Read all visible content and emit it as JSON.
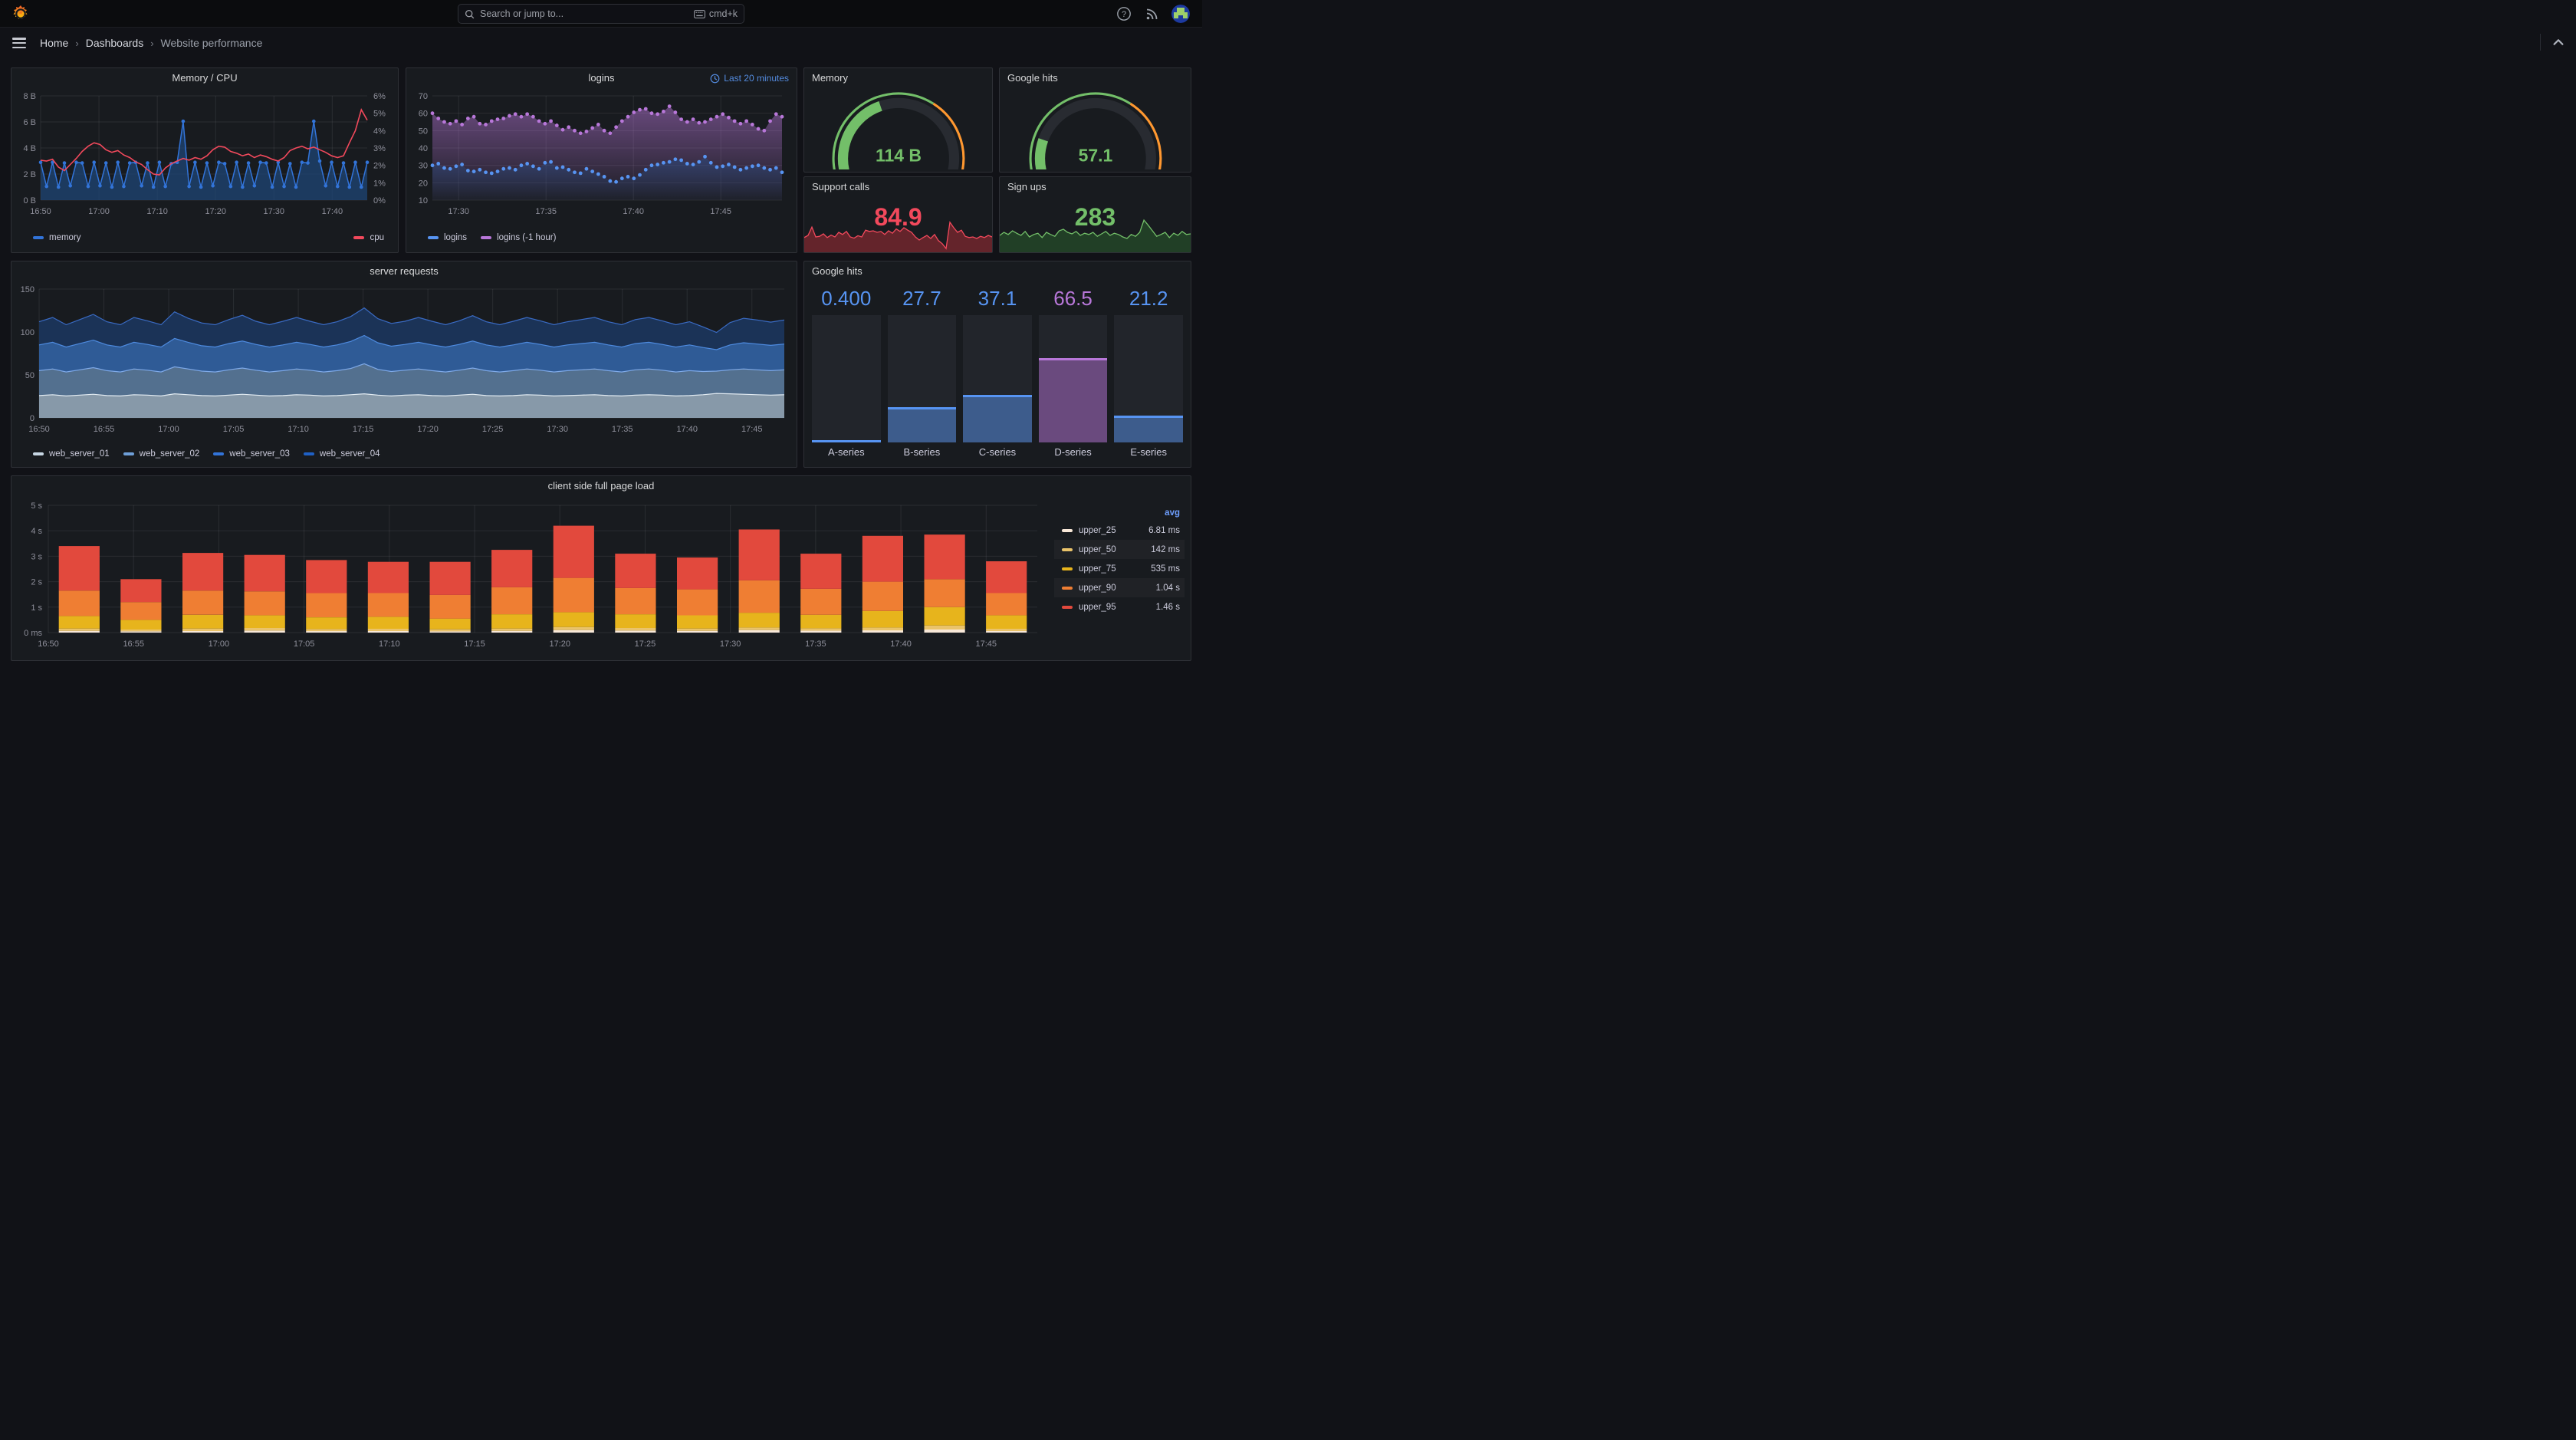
{
  "nav": {
    "search_placeholder": "Search or jump to...",
    "shortcut_label": "cmd+k"
  },
  "breadcrumb": {
    "home": "Home",
    "dashboards": "Dashboards",
    "current": "Website performance"
  },
  "panels": {
    "memory_cpu": {
      "title": "Memory / CPU",
      "legend": [
        {
          "label": "memory",
          "color": "#3274D9"
        },
        {
          "label": "cpu",
          "color": "#F2495C"
        }
      ]
    },
    "logins": {
      "title": "logins",
      "time_range": "Last 20 minutes",
      "legend": [
        {
          "label": "logins",
          "color": "#5794F2"
        },
        {
          "label": "logins (-1 hour)",
          "color": "#B877D9"
        }
      ]
    },
    "memory_gauge": {
      "title": "Memory",
      "value": "114 B"
    },
    "google_gauge": {
      "title": "Google hits",
      "value": "57.1"
    },
    "support_calls": {
      "title": "Support calls",
      "value": "84.9",
      "color": "#F2495C"
    },
    "sign_ups": {
      "title": "Sign ups",
      "value": "283",
      "color": "#73BF69"
    },
    "server_requests": {
      "title": "server requests",
      "legend": [
        {
          "label": "web_server_01",
          "color": "#C7D6E3"
        },
        {
          "label": "web_server_02",
          "color": "#6E9FD8"
        },
        {
          "label": "web_server_03",
          "color": "#3274D9"
        },
        {
          "label": "web_server_04",
          "color": "#1F60C4"
        }
      ]
    },
    "google_hits_bars": {
      "title": "Google hits"
    },
    "client_load": {
      "title": "client side full page load",
      "legend_header": "avg",
      "legend": [
        {
          "label": "upper_25",
          "avg": "6.81 ms",
          "color": "#F8E8D8"
        },
        {
          "label": "upper_50",
          "avg": "142 ms",
          "color": "#EAC36A"
        },
        {
          "label": "upper_75",
          "avg": "535 ms",
          "color": "#E7B41C"
        },
        {
          "label": "upper_90",
          "avg": "1.04 s",
          "color": "#EF7E33"
        },
        {
          "label": "upper_95",
          "avg": "1.46 s",
          "color": "#E2493D"
        }
      ]
    }
  },
  "chart_data": {
    "memcpu": {
      "type": "line",
      "title": "Memory / CPU",
      "x_ticks": [
        "16:50",
        "17:00",
        "17:10",
        "17:20",
        "17:30",
        "17:40"
      ],
      "y_left_ticks": [
        "0 B",
        "2 B",
        "4 B",
        "6 B",
        "8 B"
      ],
      "y_left_range": [
        0,
        8
      ],
      "y_right_ticks": [
        "0%",
        "1%",
        "2%",
        "3%",
        "4%",
        "5%",
        "6%"
      ],
      "y_right_range": [
        0,
        6
      ],
      "series": [
        {
          "name": "memory",
          "axis": "left",
          "color": "#3274D9",
          "fill": "rgba(31,70,120,0.72)",
          "points": true,
          "values": [
            2.9,
            1.05,
            2.9,
            1,
            2.85,
            1.1,
            2.9,
            2.85,
            1.05,
            2.9,
            1.1,
            2.85,
            1,
            2.9,
            1.05,
            2.85,
            2.9,
            1.1,
            2.85,
            1,
            2.9,
            1.05,
            2.8,
            2.9,
            6.05,
            1.05,
            2.9,
            1,
            2.85,
            1.1,
            2.9,
            2.8,
            1.05,
            2.9,
            1,
            2.85,
            1.1,
            2.9,
            2.85,
            1,
            2.9,
            1.05,
            2.8,
            1,
            2.9,
            2.85,
            6.05,
            3,
            1.1,
            2.9,
            1.05,
            2.85,
            1,
            2.9,
            1,
            2.9
          ]
        },
        {
          "name": "cpu",
          "axis": "right",
          "color": "#F2495C",
          "points": false,
          "values": [
            2.3,
            2.25,
            2.35,
            1.9,
            1.7,
            2.05,
            2.4,
            2.8,
            3.1,
            3.3,
            3.2,
            2.9,
            2.75,
            2.85,
            2.6,
            2.45,
            2.2,
            2.05,
            1.75,
            1.5,
            1.45,
            1.85,
            2.1,
            2.25,
            2.4,
            2.3,
            2.45,
            2.35,
            2.55,
            2.9,
            3.1,
            3.05,
            2.8,
            2.7,
            2.55,
            2.65,
            2.45,
            2.6,
            2.5,
            2.35,
            2.25,
            2.45,
            2.85,
            3,
            3.1,
            2.95,
            3.05,
            2.9,
            2.75,
            2.55,
            2.45,
            2.55,
            3.3,
            4,
            5.2,
            4.6
          ]
        }
      ]
    },
    "logins": {
      "type": "points",
      "title": "logins",
      "time_range": "Last 20 minutes",
      "x_ticks": [
        "17:30",
        "17:35",
        "17:40",
        "17:45"
      ],
      "x_tick_fracs": [
        0.075,
        0.325,
        0.575,
        0.825
      ],
      "y_ticks": [
        "10",
        "20",
        "30",
        "40",
        "50",
        "60",
        "70"
      ],
      "y_range": [
        10,
        70
      ],
      "series": [
        {
          "name": "logins (-1 hour)",
          "color": "#B877D9",
          "fill_top": "rgba(184,119,217,0.50)",
          "fill_bot": "rgba(184,119,217,0.03)",
          "values": [
            60,
            57,
            55,
            54,
            55.5,
            53.5,
            57,
            58,
            54,
            53.5,
            55.5,
            56.5,
            57,
            58.5,
            59.5,
            58,
            59.5,
            58,
            55.5,
            54,
            55.5,
            53,
            50.5,
            52,
            50,
            48.5,
            49.5,
            51.5,
            53.5,
            50,
            48.5,
            52,
            55.5,
            58,
            60.5,
            62,
            62.5,
            60,
            59.5,
            61,
            64,
            60.5,
            56.5,
            55,
            56.5,
            54.5,
            55,
            56.5,
            58,
            59.5,
            57.5,
            55.5,
            54,
            55.5,
            53.5,
            51,
            50,
            55.5,
            59.5,
            58
          ]
        },
        {
          "name": "logins",
          "color": "#5794F2",
          "fill_top": "rgba(40,75,130,0.55)",
          "fill_bot": "rgba(40,75,130,0.05)",
          "values": [
            30,
            31,
            28.5,
            28,
            29.5,
            30.5,
            27,
            26.5,
            27.5,
            26,
            25.5,
            26.5,
            28,
            28.5,
            27.5,
            30,
            31,
            29.5,
            28,
            31.5,
            32,
            28.5,
            29,
            27.5,
            26,
            25.5,
            28,
            26.5,
            25,
            23.5,
            21,
            20.5,
            22.5,
            23.5,
            22.5,
            24.5,
            27.5,
            30,
            30.5,
            31.5,
            32,
            33.5,
            33,
            31,
            30.5,
            32,
            35,
            31.5,
            29,
            29.5,
            30.5,
            29,
            27.5,
            28.5,
            29.5,
            30,
            28.5,
            27.5,
            28.5,
            26
          ]
        }
      ]
    },
    "server": {
      "type": "stacked_area",
      "title": "server requests",
      "x_ticks": [
        "16:50",
        "16:55",
        "17:00",
        "17:05",
        "17:10",
        "17:15",
        "17:20",
        "17:25",
        "17:30",
        "17:35",
        "17:40",
        "17:45"
      ],
      "y_ticks": [
        "0",
        "50",
        "100",
        "150"
      ],
      "y_range": [
        0,
        150
      ],
      "series": [
        {
          "name": "web_server_01",
          "fill": "#8799A9",
          "line": "#E2EBF2",
          "values": [
            26,
            27,
            25.5,
            26.5,
            27.5,
            26,
            25.5,
            27,
            26.5,
            25.5,
            28,
            27,
            26,
            25.5,
            26.5,
            27.5,
            26.5,
            25.5,
            26,
            27,
            26.5,
            25.5,
            26,
            27,
            28,
            26.5,
            25.5,
            26.5,
            27,
            26,
            25.5,
            26.5,
            27.5,
            26,
            25.5,
            26,
            27,
            26.5,
            25.5,
            26,
            26.5,
            27,
            26,
            25.5,
            26.5,
            27,
            26.5,
            25.5,
            26,
            27,
            28.5,
            28,
            27.5,
            27,
            26.5,
            27
          ]
        },
        {
          "name": "web_server_02",
          "fill": "#53708F",
          "line": "#7EA9E8",
          "values": [
            29,
            30,
            28,
            29.5,
            31,
            29,
            28,
            30,
            29,
            28,
            31.5,
            30,
            28.5,
            28,
            29.5,
            30.5,
            29,
            28,
            29,
            30,
            29,
            28,
            29,
            30.5,
            35,
            30,
            28.5,
            29,
            30,
            29,
            28,
            29,
            30.5,
            29,
            28,
            29,
            30,
            29,
            28,
            29,
            29.5,
            30,
            29,
            28,
            29.5,
            30,
            29,
            28,
            29,
            27,
            26,
            28,
            29.5,
            29,
            28.5,
            29
          ]
        },
        {
          "name": "web_server_03",
          "fill": "#2F5B96",
          "line": "#4E8BE0",
          "values": [
            30,
            31,
            29,
            30.5,
            32,
            30,
            29,
            31,
            30,
            29,
            33,
            31,
            29.5,
            29,
            30.5,
            31.5,
            30,
            29,
            30,
            31,
            30,
            29,
            30,
            31.5,
            33,
            31,
            29.5,
            30,
            31,
            30,
            29,
            30,
            31.5,
            30,
            29,
            30,
            31,
            30,
            29,
            30,
            30.5,
            31,
            30,
            29,
            30.5,
            31,
            30,
            29,
            30,
            28,
            25,
            29,
            30.5,
            30,
            29.5,
            30
          ]
        },
        {
          "name": "web_server_04",
          "fill": "#1B3357",
          "line": "#3A6BC4",
          "values": [
            27,
            29,
            26,
            28,
            30,
            27,
            26,
            29,
            27.5,
            26,
            31,
            28,
            26.5,
            26,
            28,
            30,
            27,
            26,
            27.5,
            29,
            27,
            26,
            27,
            29,
            32,
            28,
            26.5,
            27,
            29,
            27.5,
            26,
            27.5,
            29.5,
            27,
            26,
            27.5,
            29,
            27.5,
            26,
            27,
            28,
            29,
            27,
            26,
            28,
            29,
            27.5,
            26,
            27,
            24,
            20,
            26,
            28.5,
            28,
            27,
            28
          ]
        }
      ]
    },
    "hits_bars": {
      "type": "bargauge",
      "title": "Google hits",
      "max": 100,
      "categories": [
        "A-series",
        "B-series",
        "C-series",
        "D-series",
        "E-series"
      ],
      "values": [
        0.4,
        27.7,
        37.1,
        66.5,
        21.2
      ],
      "value_labels": [
        "0.400",
        "27.7",
        "37.1",
        "66.5",
        "21.2"
      ],
      "value_colors": [
        "#5794F2",
        "#5794F2",
        "#5794F2",
        "#B877D9",
        "#5794F2"
      ],
      "body_colors": [
        "#3D5C8C",
        "#3D5C8C",
        "#3D5C8C",
        "#6A4A7E",
        "#3D5C8C"
      ],
      "cap_colors": [
        "#5794F2",
        "#5794F2",
        "#5794F2",
        "#B877D9",
        "#5794F2"
      ]
    },
    "client": {
      "type": "stacked_bars",
      "title": "client side full page load",
      "x_ticks": [
        "16:50",
        "16:55",
        "17:00",
        "17:05",
        "17:10",
        "17:15",
        "17:20",
        "17:25",
        "17:30",
        "17:35",
        "17:40",
        "17:45"
      ],
      "y_ticks": [
        "0 ms",
        "1 s",
        "2 s",
        "3 s",
        "4 s",
        "5 s"
      ],
      "y_range": [
        0,
        5
      ],
      "segment_names": [
        "upper_25",
        "upper_50",
        "upper_75",
        "upper_90",
        "upper_95"
      ],
      "segment_colors": [
        "#F8E8D8",
        "#EAC36A",
        "#E7B41C",
        "#EF7E33",
        "#E2493D"
      ],
      "bars_cumulative_s": [
        [
          0.07,
          0.16,
          0.65,
          1.65,
          3.4
        ],
        [
          0.05,
          0.12,
          0.5,
          1.2,
          2.1
        ],
        [
          0.06,
          0.16,
          0.7,
          1.65,
          3.13
        ],
        [
          0.08,
          0.18,
          0.68,
          1.62,
          3.05
        ],
        [
          0.06,
          0.14,
          0.6,
          1.55,
          2.85
        ],
        [
          0.06,
          0.15,
          0.62,
          1.55,
          2.78
        ],
        [
          0.05,
          0.13,
          0.55,
          1.48,
          2.78
        ],
        [
          0.07,
          0.16,
          0.72,
          1.78,
          3.25
        ],
        [
          0.1,
          0.22,
          0.8,
          2.15,
          4.2
        ],
        [
          0.08,
          0.18,
          0.72,
          1.75,
          3.1
        ],
        [
          0.07,
          0.16,
          0.68,
          1.7,
          2.95
        ],
        [
          0.1,
          0.2,
          0.78,
          2.05,
          4.05
        ],
        [
          0.08,
          0.17,
          0.7,
          1.72,
          3.1
        ],
        [
          0.09,
          0.2,
          0.85,
          2.0,
          3.8
        ],
        [
          0.12,
          0.28,
          1.0,
          2.1,
          3.85
        ],
        [
          0.06,
          0.15,
          0.68,
          1.55,
          2.8
        ]
      ]
    },
    "memory_gauge": {
      "type": "gauge",
      "value_text": "114 B",
      "fill_frac": 0.43,
      "ring": [
        [
          0,
          0.62,
          "#73BF69"
        ],
        [
          0.62,
          0.88,
          "#FF9830"
        ],
        [
          0.88,
          1,
          "#F2495C"
        ]
      ]
    },
    "google_gauge": {
      "type": "gauge",
      "value_text": "57.1",
      "fill_frac": 0.24,
      "ring": [
        [
          0,
          0.62,
          "#73BF69"
        ],
        [
          0.62,
          0.88,
          "#FF9830"
        ],
        [
          0.88,
          1,
          "#F2495C"
        ]
      ]
    },
    "support_spark": {
      "type": "spark",
      "color": "#F2495C",
      "fill": "rgba(164,44,53,0.55)",
      "values": [
        38,
        45,
        72,
        40,
        42,
        50,
        38,
        46,
        40,
        55,
        48,
        58,
        40,
        36,
        44,
        40,
        62,
        58,
        60,
        55,
        58,
        48,
        60,
        52,
        66,
        58,
        70,
        62,
        55,
        40,
        30,
        38,
        45,
        35,
        48,
        28,
        18,
        2,
        88,
        70,
        55,
        62,
        42,
        38,
        40,
        35,
        42,
        38,
        45,
        40
      ]
    },
    "signups_spark": {
      "type": "spark",
      "color": "#73BF69",
      "fill": "rgba(42,93,43,0.55)",
      "values": [
        45,
        55,
        48,
        60,
        52,
        45,
        58,
        40,
        48,
        52,
        38,
        55,
        48,
        42,
        60,
        65,
        55,
        50,
        58,
        45,
        52,
        48,
        55,
        42,
        50,
        58,
        45,
        52,
        48,
        40,
        35,
        48,
        42,
        55,
        95,
        78,
        60,
        42,
        48,
        55,
        38,
        52,
        45,
        58,
        48,
        50
      ]
    }
  }
}
